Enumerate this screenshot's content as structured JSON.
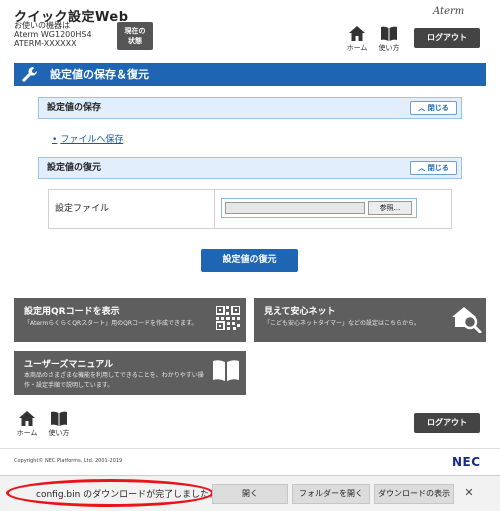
{
  "header": {
    "title": "クイック設定Web",
    "model_lines": [
      "お使いの機器は",
      "Aterm WG1200HS4",
      "ATERM-XXXXXX"
    ],
    "status_button": [
      "現在の",
      "状態"
    ],
    "brand_logo": "Aterm",
    "home_label": "ホーム",
    "usage_label": "使い方",
    "logout_label": "ログアウト"
  },
  "section": {
    "title": "設定値の保存＆復元"
  },
  "save": {
    "header": "設定値の保存",
    "close_label": "閉じる",
    "link_label": "ファイルへ保存"
  },
  "restore": {
    "header": "設定値の復元",
    "close_label": "閉じる",
    "file_label": "設定ファイル",
    "browse_label": "参照...",
    "button_label": "設定値の復元"
  },
  "tiles": {
    "qr": {
      "title": "設定用QRコードを表示",
      "desc": "「AtermらくらくQRスタート」用のQRコードを作成できます。"
    },
    "safety": {
      "title": "見えて安心ネット",
      "desc": "「こども安心ネットタイマー」などの設定はこちらから。"
    },
    "manual": {
      "title": "ユーザーズマニュアル",
      "desc_lines": [
        "本商品のさまざまな機能を利用してできることを、わかりやすい操",
        "作・設定手順で説明しています。"
      ]
    }
  },
  "footer": {
    "home_label": "ホーム",
    "usage_label": "使い方",
    "logout_label": "ログアウト",
    "copyright": "Copyright© NEC Platforms, Ltd. 2001-2019",
    "logo": "NEC"
  },
  "download_bar": {
    "message": "config.bin のダウンロードが完了しました。",
    "open_label": "開く",
    "open_folder_label": "フォルダーを開く",
    "show_downloads_label": "ダウンロードの表示",
    "close_glyph": "✕"
  },
  "colors": {
    "accent_blue": "#1e66b4",
    "tile_gray": "#5e5e5e",
    "highlight_red": "#e8141a"
  }
}
